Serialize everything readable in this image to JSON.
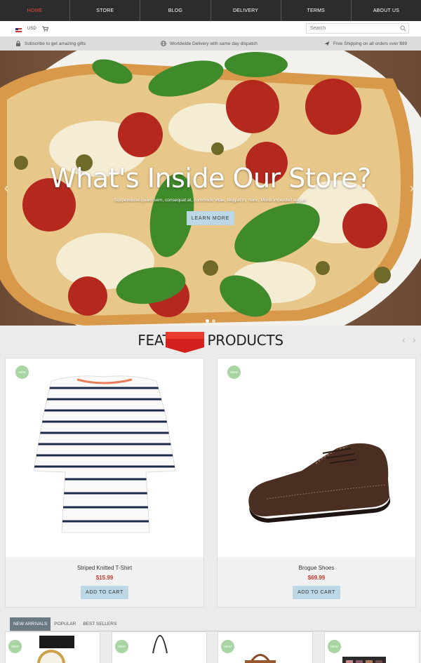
{
  "nav": {
    "items": [
      "HOME",
      "STORE",
      "BLOG",
      "DELIVERY",
      "TERMS",
      "ABOUT US"
    ],
    "active": "HOME",
    "active_color": "#e04a3c"
  },
  "util": {
    "currency": "USD",
    "search_placeholder": "Search"
  },
  "info": {
    "subscribe": "Subscribe to get amazing gifts",
    "delivery": "Worldwide Delivery with same day dispatch",
    "shipping": "Free Shipping on all orders over $99"
  },
  "hero": {
    "title": "What's Inside Our Store?",
    "subtitle": "Suspendisse quam sem, consequat at, commodo vitae, feugiat in, nunc. Morbi imperdiet augue.",
    "button": "LEARN MORE",
    "slides": 2,
    "current_slide": 1
  },
  "featured": {
    "title_left": "FEAT",
    "title_right": "PRODUCTS",
    "ribbon_color": "#d41f1f",
    "products": [
      {
        "name": "Striped Knitted T-Shirt",
        "price": "$15.99",
        "badge": "NEW",
        "button": "ADD TO CART"
      },
      {
        "name": "Brogue Shoes",
        "price": "$69.99",
        "badge": "NEW",
        "button": "ADD TO CART"
      }
    ]
  },
  "tabs": {
    "items": [
      "NEW ARRIVALS",
      "POPULAR",
      "BEST SELLERS"
    ],
    "active": "NEW ARRIVALS"
  },
  "new_arrivals": [
    {
      "badge": "NEW",
      "icon": "watch-icon"
    },
    {
      "badge": "NEW",
      "icon": "bag-icon"
    },
    {
      "badge": "NEW",
      "icon": "handbag-icon"
    },
    {
      "badge": "NEW",
      "icon": "palette-icon"
    }
  ]
}
